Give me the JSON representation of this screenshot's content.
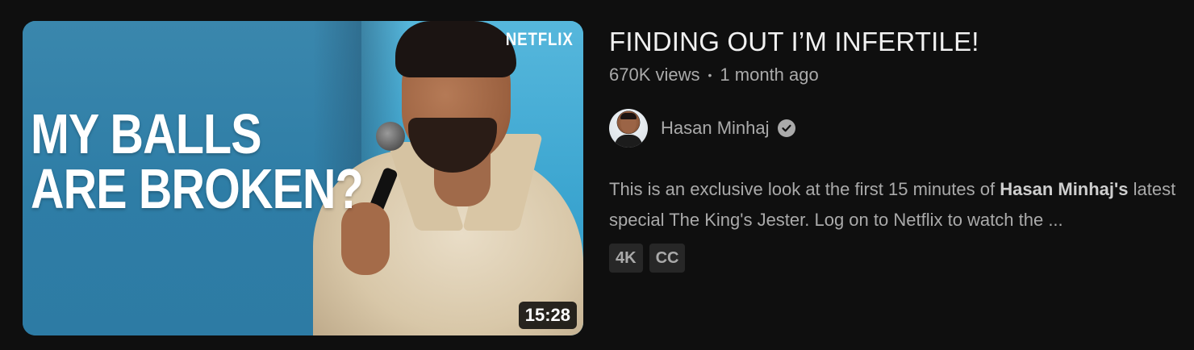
{
  "thumbnail": {
    "title_line1": "MY BALLS",
    "title_line2": "ARE BROKEN?",
    "brand": "NETFLIX",
    "duration": "15:28"
  },
  "video": {
    "title": "FINDING OUT I’M INFERTILE!",
    "views": "670K views",
    "separator": "•",
    "age": "1 month ago"
  },
  "channel": {
    "name": "Hasan Minhaj",
    "verified_icon": "verified-check-icon"
  },
  "description": {
    "part1": "This is an exclusive look at the first 15 minutes of ",
    "bold": "Hasan Minhaj's",
    "part2": " latest special The King's Jester. Log on to Netflix to watch the ..."
  },
  "badges": [
    "4K",
    "CC"
  ],
  "colors": {
    "background": "#0f0f0f",
    "title_text": "#f1f1f1",
    "secondary_text": "#aaaaaa",
    "badge_bg": "#272727"
  }
}
